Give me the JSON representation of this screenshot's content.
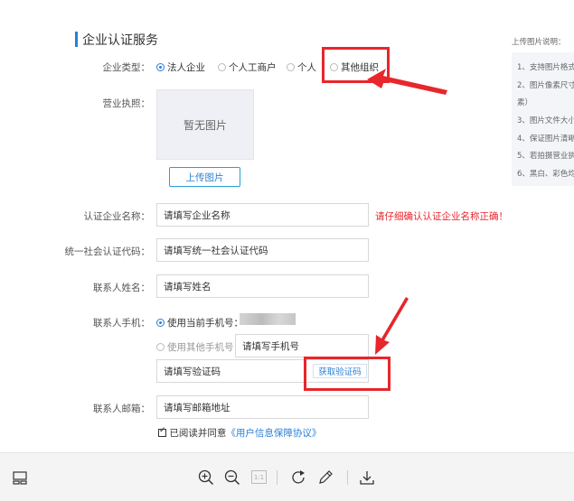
{
  "section": {
    "title": "企业认证服务"
  },
  "enterprise_type": {
    "label": "企业类型：",
    "options": [
      {
        "label": "法人企业",
        "selected": true
      },
      {
        "label": "个人工商户",
        "selected": false
      },
      {
        "label": "个人",
        "selected": false
      },
      {
        "label": "其他组织",
        "selected": false
      }
    ]
  },
  "license": {
    "label": "营业执照：",
    "placeholder_text": "暂无图片",
    "upload_label": "上传图片"
  },
  "company_name": {
    "label": "认证企业名称：",
    "placeholder": "请填写企业名称",
    "warning": "请仔细确认认证企业名称正确！"
  },
  "credit_code": {
    "label": "统一社会认证代码：",
    "placeholder": "请填写统一社会认证代码"
  },
  "contact_name": {
    "label": "联系人姓名：",
    "placeholder": "请填写姓名"
  },
  "contact_phone": {
    "label": "联系人手机：",
    "use_current_label": "使用当前手机号：",
    "use_other_label": "使用其他手机号：",
    "phone_placeholder": "请填写手机号",
    "code_placeholder": "请填写验证码",
    "get_code_label": "获取验证码"
  },
  "contact_email": {
    "label": "联系人邮箱：",
    "placeholder": "请填写邮箱地址"
  },
  "agreement": {
    "prefix": "已阅读并同意",
    "link": "《用户信息保障协议》",
    "checked": true
  },
  "sidebar": {
    "title": "上传图片说明：",
    "tips": [
      "1、支持图片格式",
      "2、图片像素尺寸",
      "素）",
      "3、图片文件大小",
      "4、保证图片清晰",
      "5、若拍摄营业执",
      "6、黑白、彩色均"
    ]
  },
  "toolbar": {
    "page_box": "1:1"
  },
  "colors": {
    "accent": "#2a7fd4",
    "annotation_red": "#e8262c"
  }
}
